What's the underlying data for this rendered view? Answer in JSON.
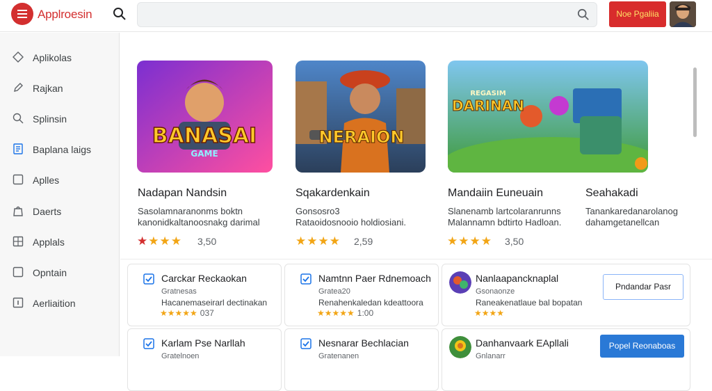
{
  "header": {
    "brand": "Applroesin",
    "search_placeholder": "",
    "signin_label": "Noe Pgaliia"
  },
  "sidebar": {
    "items": [
      {
        "label": "Aplikolas",
        "icon": "diamond-icon"
      },
      {
        "label": "Rajkan",
        "icon": "pen-icon"
      },
      {
        "label": "Splinsin",
        "icon": "search-icon"
      },
      {
        "label": "Baplana laigs",
        "icon": "document-icon"
      },
      {
        "label": "Aplles",
        "icon": "square-icon"
      },
      {
        "label": "Daerts",
        "icon": "bag-icon"
      },
      {
        "label": "Applals",
        "icon": "grid-icon"
      },
      {
        "label": "Opntain",
        "icon": "square-icon"
      },
      {
        "label": "Aerliaition",
        "icon": "info-icon"
      }
    ]
  },
  "featured": [
    {
      "image_title": "BANASAI",
      "image_subtitle": "GAME",
      "title": "Nadapan Nandsin",
      "desc1": "Sasolamnaranonms boktn",
      "desc2": "kanonidkaltanoosnakg darimal",
      "rating": "3,50",
      "palette": [
        "#7b2fd1",
        "#ff4fa0"
      ]
    },
    {
      "image_title": "NERAION",
      "image_subtitle": "",
      "title": "Sqakardenkain",
      "desc1": "Gonsosro3",
      "desc2": "Rataoidosnooio holdiosiani.",
      "rating": "2,59",
      "palette": [
        "#3b6fb5",
        "#d9721f"
      ]
    },
    {
      "image_title": "DARINAN",
      "image_subtitle": "REGASIM",
      "title": "Mandaiin Euneuain",
      "desc1": "Slanenamb lartcolaranrunns",
      "desc2": "Malannamn bdtirto Hadloan.",
      "rating": "3,50",
      "palette": [
        "#2f9a3c",
        "#8ccf4f"
      ]
    },
    {
      "title": "Seahakadi",
      "desc1": "Tanankaredanarolanog",
      "desc2": "dahamgetanellcan"
    }
  ],
  "list": [
    {
      "title": "Carckar Reckaokan",
      "sub": "Gratnesas",
      "desc": "Hacanemaseirarl dectinakan",
      "rating": "037"
    },
    {
      "title": "Namtnn Paer Rdnemoach",
      "sub": "Gratea20",
      "desc": "Renahenkaledan kdeattoora",
      "rating": "1:00"
    },
    {
      "title": "Nanlaapancknaplal",
      "sub": "Gsonaonze",
      "desc": "Raneakenatlaue bal bopatan",
      "rating": "",
      "button": "Pndandar Pasr"
    },
    {
      "title": "Karlam Pse Narllah",
      "sub": "Gratelnoen",
      "desc": "",
      "rating": ""
    },
    {
      "title": "Nesnarar Bechlacian",
      "sub": "Gratenanen",
      "desc": "",
      "rating": ""
    },
    {
      "title": "Danhanvaark EApllali",
      "sub": "Gnlanarr",
      "desc": "",
      "rating": "",
      "button": "Popel Reonaboas"
    }
  ],
  "colors": {
    "accent": "#d32f2f",
    "primary": "#2a79d6",
    "star": "#f2a515"
  }
}
